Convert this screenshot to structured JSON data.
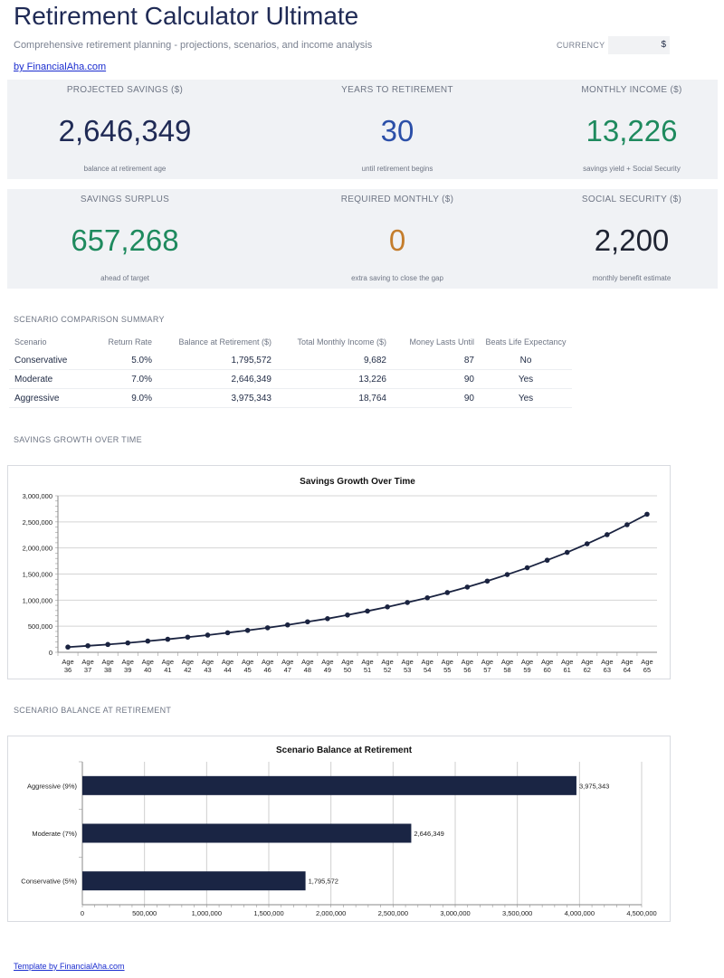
{
  "header": {
    "title": "Retirement Calculator Ultimate",
    "subtitle": "Comprehensive retirement planning - projections, scenarios, and income analysis",
    "currency_label": "CURRENCY",
    "currency_value": "$",
    "link": "by FinancialAha.com"
  },
  "kpis_row1": [
    {
      "label": "PROJECTED SAVINGS ($)",
      "value": "2,646,349",
      "sub": "balance at retirement age",
      "color": "#1f2a55"
    },
    {
      "label": "YEARS TO RETIREMENT",
      "value": "30",
      "sub": "until retirement begins",
      "color": "#2b4fa8"
    },
    {
      "label": "MONTHLY INCOME ($)",
      "value": "13,226",
      "sub": "savings yield + Social Security",
      "color": "#1e8a5e"
    }
  ],
  "kpis_row2": [
    {
      "label": "SAVINGS SURPLUS",
      "value": "657,268",
      "sub": "ahead of target",
      "color": "#1e8a5e"
    },
    {
      "label": "REQUIRED MONTHLY ($)",
      "value": "0",
      "sub": "extra saving to close the gap",
      "color": "#c47d2c"
    },
    {
      "label": "SOCIAL SECURITY ($)",
      "value": "2,200",
      "sub": "monthly benefit estimate",
      "color": "#1f2433"
    }
  ],
  "scenario_table": {
    "section_title": "SCENARIO COMPARISON SUMMARY",
    "headers": [
      "Scenario",
      "Return Rate",
      "Balance at Retirement ($)",
      "Total Monthly Income ($)",
      "Money Lasts Until",
      "Beats Life Expectancy"
    ],
    "rows": [
      [
        "Conservative",
        "5.0%",
        "1,795,572",
        "9,682",
        "87",
        "No"
      ],
      [
        "Moderate",
        "7.0%",
        "2,646,349",
        "13,226",
        "90",
        "Yes"
      ],
      [
        "Aggressive",
        "9.0%",
        "3,975,343",
        "18,764",
        "90",
        "Yes"
      ]
    ]
  },
  "growth_section_title": "SAVINGS GROWTH OVER TIME",
  "balance_section_title": "SCENARIO BALANCE AT RETIREMENT",
  "footer_link": "Template by FinancialAha.com",
  "chart_data": [
    {
      "type": "line",
      "title": "Savings Growth Over Time",
      "x": [
        "Age 36",
        "Age 37",
        "Age 38",
        "Age 39",
        "Age 40",
        "Age 41",
        "Age 42",
        "Age 43",
        "Age 44",
        "Age 45",
        "Age 46",
        "Age 47",
        "Age 48",
        "Age 49",
        "Age 50",
        "Age 51",
        "Age 52",
        "Age 53",
        "Age 54",
        "Age 55",
        "Age 56",
        "Age 57",
        "Age 58",
        "Age 59",
        "Age 60",
        "Age 61",
        "Age 62",
        "Age 63",
        "Age 64",
        "Age 65"
      ],
      "values": [
        100000,
        125000,
        150000,
        180000,
        215000,
        250000,
        290000,
        330000,
        375000,
        420000,
        470000,
        525000,
        585000,
        645000,
        715000,
        790000,
        870000,
        955000,
        1045000,
        1145000,
        1250000,
        1365000,
        1490000,
        1620000,
        1765000,
        1915000,
        2080000,
        2255000,
        2445000,
        2646349
      ],
      "ylim": [
        0,
        3000000
      ],
      "yticks": [
        "0",
        "500,000",
        "1,000,000",
        "1,500,000",
        "2,000,000",
        "2,500,000",
        "3,000,000"
      ],
      "grid": true,
      "line_color": "#1a2340"
    },
    {
      "type": "bar",
      "orientation": "horizontal",
      "title": "Scenario Balance at Retirement",
      "categories": [
        "Aggressive (9%)",
        "Moderate (7%)",
        "Conservative (5%)"
      ],
      "values": [
        3975343,
        2646349,
        1795572
      ],
      "data_labels": [
        "3,975,343",
        "2,646,349",
        "1,795,572"
      ],
      "xlim": [
        0,
        4500000
      ],
      "xticks": [
        "0",
        "500,000",
        "1,000,000",
        "1,500,000",
        "2,000,000",
        "2,500,000",
        "3,000,000",
        "3,500,000",
        "4,000,000",
        "4,500,000"
      ],
      "grid": true,
      "bar_color": "#1a2544"
    }
  ]
}
